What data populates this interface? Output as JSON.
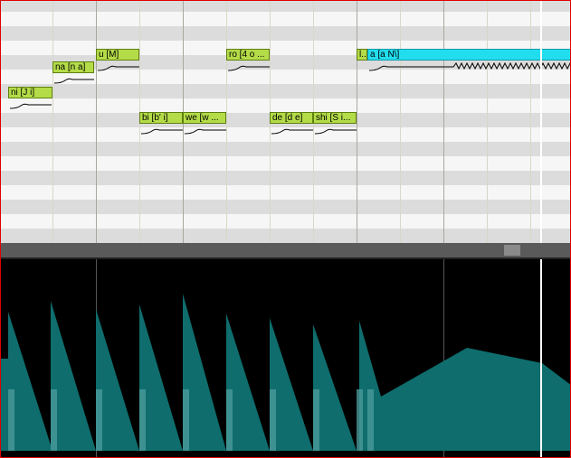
{
  "piano_roll": {
    "notes": [
      {
        "label": "ni [J i]"
      },
      {
        "label": "na [n a]"
      },
      {
        "label": "u [M]"
      },
      {
        "label": "bi [b' i]"
      },
      {
        "label": "we [w ..."
      },
      {
        "label": "ro [4 o ..."
      },
      {
        "label": "de [d e]"
      },
      {
        "label": "shi [S i..."
      },
      {
        "label": "l..."
      },
      {
        "label": "a [a N\\]"
      }
    ]
  },
  "colors": {
    "note_fill": "#b4dc48",
    "note_selected_fill": "#22ddee",
    "envelope_fill": "#0f6d6d",
    "playhead": "#ffffff",
    "frame_border": "#e00000"
  }
}
